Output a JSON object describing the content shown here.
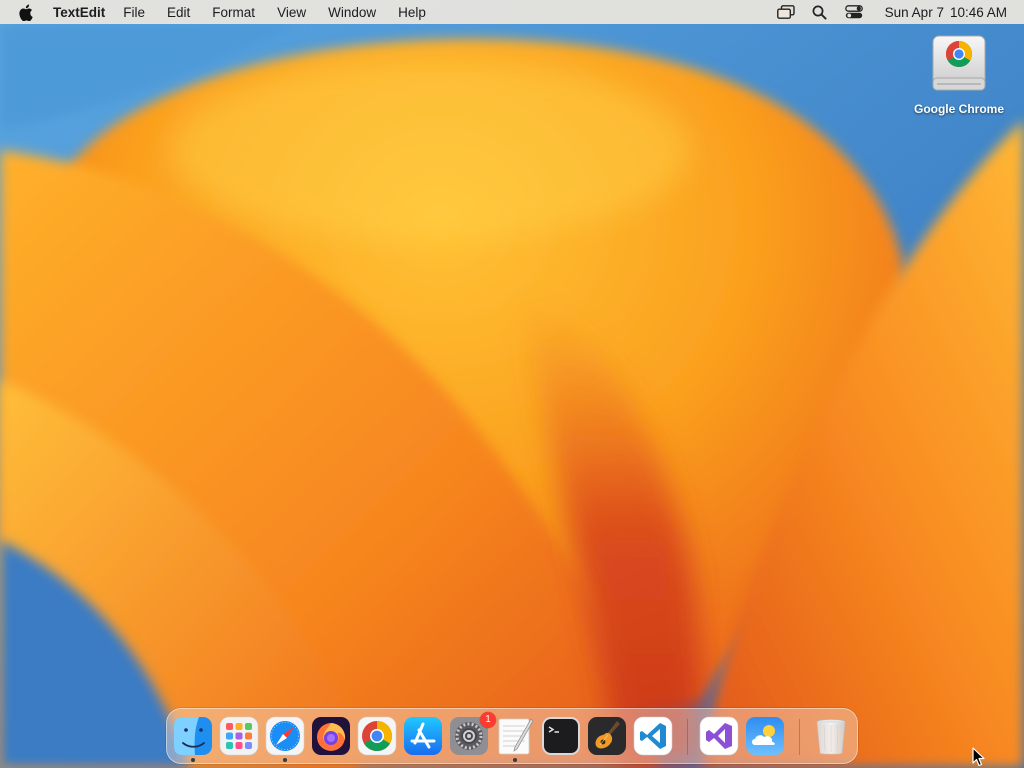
{
  "menubar": {
    "app_name": "TextEdit",
    "items": [
      "File",
      "Edit",
      "Format",
      "View",
      "Window",
      "Help"
    ],
    "clock": {
      "date": "Sun Apr 7",
      "time": "10:46 AM"
    },
    "status_icons": [
      "screen-mirroring-icon",
      "spotlight-search-icon",
      "control-center-icon"
    ]
  },
  "desktop": {
    "icons": [
      {
        "label": "Google Chrome",
        "icon": "chrome-drive-icon"
      }
    ]
  },
  "dock": {
    "apps": [
      {
        "icon": "finder-icon",
        "running": true
      },
      {
        "icon": "launchpad-icon",
        "running": false
      },
      {
        "icon": "safari-icon",
        "running": true
      },
      {
        "icon": "firefox-icon",
        "running": false
      },
      {
        "icon": "chrome-icon",
        "running": false
      },
      {
        "icon": "app-store-icon",
        "running": false
      },
      {
        "icon": "system-settings-icon",
        "running": false,
        "badge": "1"
      },
      {
        "icon": "textedit-icon",
        "running": true
      },
      {
        "icon": "terminal-icon",
        "running": false
      },
      {
        "icon": "garageband-icon",
        "running": false
      },
      {
        "icon": "vscode-icon",
        "running": false
      },
      {
        "icon": "visual-studio-icon",
        "running": false
      },
      {
        "icon": "weather-icon",
        "running": false
      },
      {
        "icon": "trash-icon",
        "running": false
      }
    ]
  },
  "colors": {
    "wallpaper_blue": "#3f86c9",
    "wallpaper_orange": "#f7931e",
    "wallpaper_yellow": "#ffc93c",
    "wallpaper_red": "#d9401f",
    "badge_red": "#ff3b30"
  }
}
